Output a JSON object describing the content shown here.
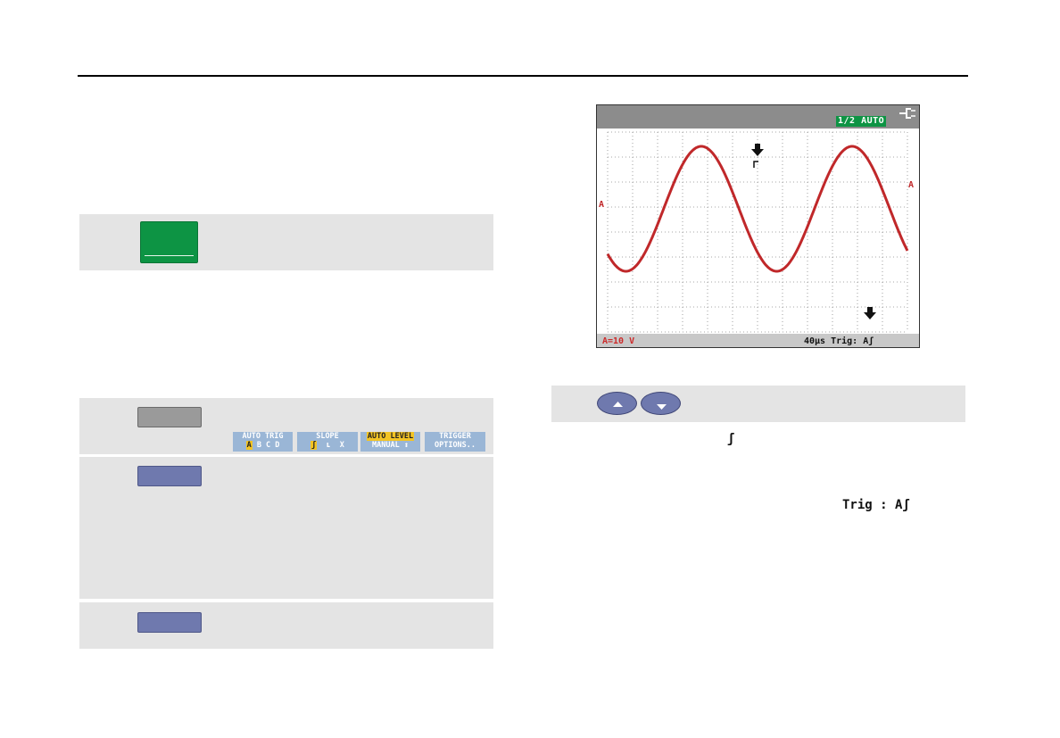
{
  "colors": {
    "green_key": "#0d9444",
    "blue_key": "#6f79ae",
    "gray_key": "#9a9a9a",
    "panel": "#e4e4e4",
    "softkey": "#9ab6d6",
    "softkey_highlight": "#f3c424",
    "trace": "#c0282a"
  },
  "softkeys": [
    {
      "line1": "AUTO TRIG",
      "line2": "A B C D"
    },
    {
      "line1": "SLOPE",
      "line2": "ʃ ʟ X"
    },
    {
      "line1": "AUTO LEVEL",
      "line2": "MANUAL ↕"
    },
    {
      "line1": "TRIGGER",
      "line2": "OPTIONS.."
    }
  ],
  "scope": {
    "status_badge": "1/2 AUTO",
    "channel_marker": "A",
    "channel_readout": "A=10 V",
    "timebase_trigger": "40µs Trig: Aʃ",
    "icons": [
      "power-plug-icon",
      "trigger-arrow-icon",
      "trigger-arrow-icon"
    ]
  },
  "arrow_buttons": [
    "up-arrow-icon",
    "down-arrow-icon"
  ],
  "text": {
    "slope_symbol": "ʃ",
    "trig_indicator": "Trig : Aʃ"
  }
}
